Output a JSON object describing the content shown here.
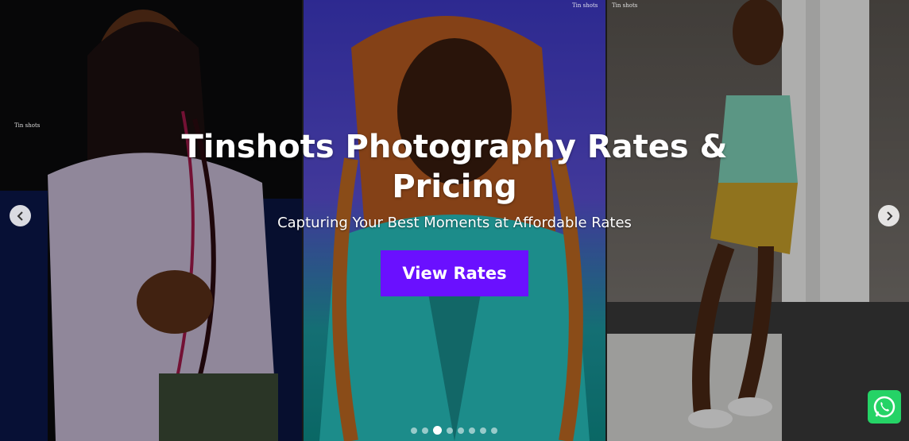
{
  "hero": {
    "title": "Tinshots Photography Rates & Pricing",
    "subtitle": "Capturing Your Best Moments at Affordable Rates",
    "cta_label": "View Rates",
    "slide_count": 8,
    "active_slide_index": 2
  },
  "images": [
    {
      "alt": "Woman in lavender t-shirt with braids"
    },
    {
      "alt": "Woman with copper braids in teal jacket"
    },
    {
      "alt": "Woman posing by white column"
    }
  ],
  "icons": {
    "prev": "chevron-left-icon",
    "next": "chevron-right-icon",
    "whatsapp": "whatsapp-icon"
  },
  "colors": {
    "cta": "#6a10ff",
    "whatsapp": "#25d366"
  }
}
